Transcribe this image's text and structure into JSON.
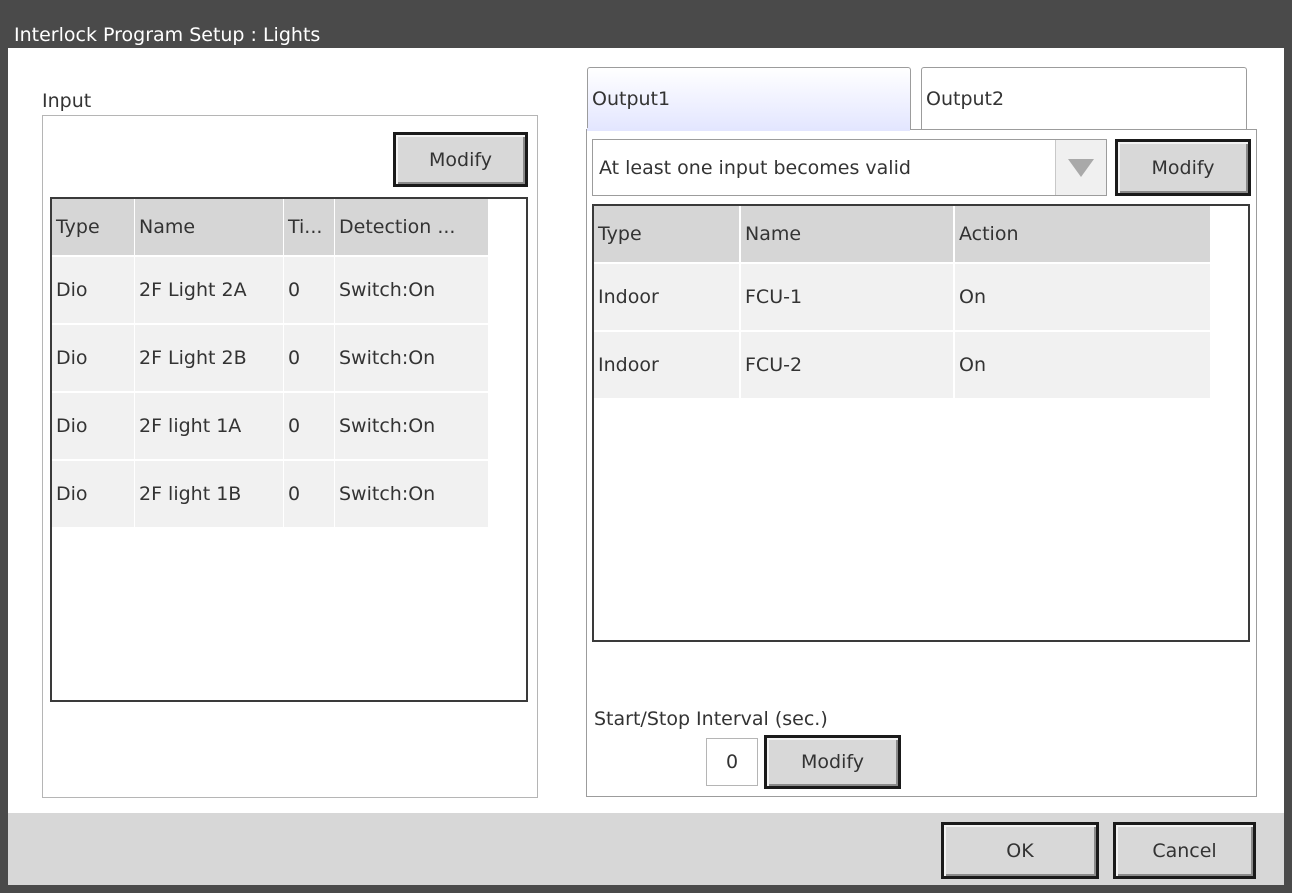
{
  "window": {
    "title": "Interlock Program Setup : Lights"
  },
  "input": {
    "label": "Input",
    "modify_label": "Modify",
    "columns": [
      "Type",
      "Name",
      "Ti...",
      "Detection ..."
    ],
    "rows": [
      [
        "Dio",
        "2F Light 2A",
        "0",
        "Switch:On"
      ],
      [
        "Dio",
        "2F Light 2B",
        "0",
        "Switch:On"
      ],
      [
        "Dio",
        "2F light 1A",
        "0",
        "Switch:On"
      ],
      [
        "Dio",
        "2F light 1B",
        "0",
        "Switch:On"
      ]
    ]
  },
  "output": {
    "tabs": [
      {
        "label": "Output1",
        "selected": true
      },
      {
        "label": "Output2",
        "selected": false
      }
    ],
    "condition": {
      "selected": "At least one input becomes valid"
    },
    "modify_label": "Modify",
    "columns": [
      "Type",
      "Name",
      "Action"
    ],
    "rows": [
      [
        "Indoor",
        "FCU-1",
        "On"
      ],
      [
        "Indoor",
        "FCU-2",
        "On"
      ]
    ],
    "interval": {
      "label": "Start/Stop Interval (sec.)",
      "value": "0",
      "modify_label": "Modify"
    }
  },
  "footer": {
    "ok_label": "OK",
    "cancel_label": "Cancel"
  },
  "colors": {
    "titlebar": "#4a4a4a",
    "header_cell": "#d6d6d6",
    "row_cell": "#f1f1f1",
    "tab_selected": "#e6e8ff",
    "bottombar": "#d7d7d7"
  }
}
